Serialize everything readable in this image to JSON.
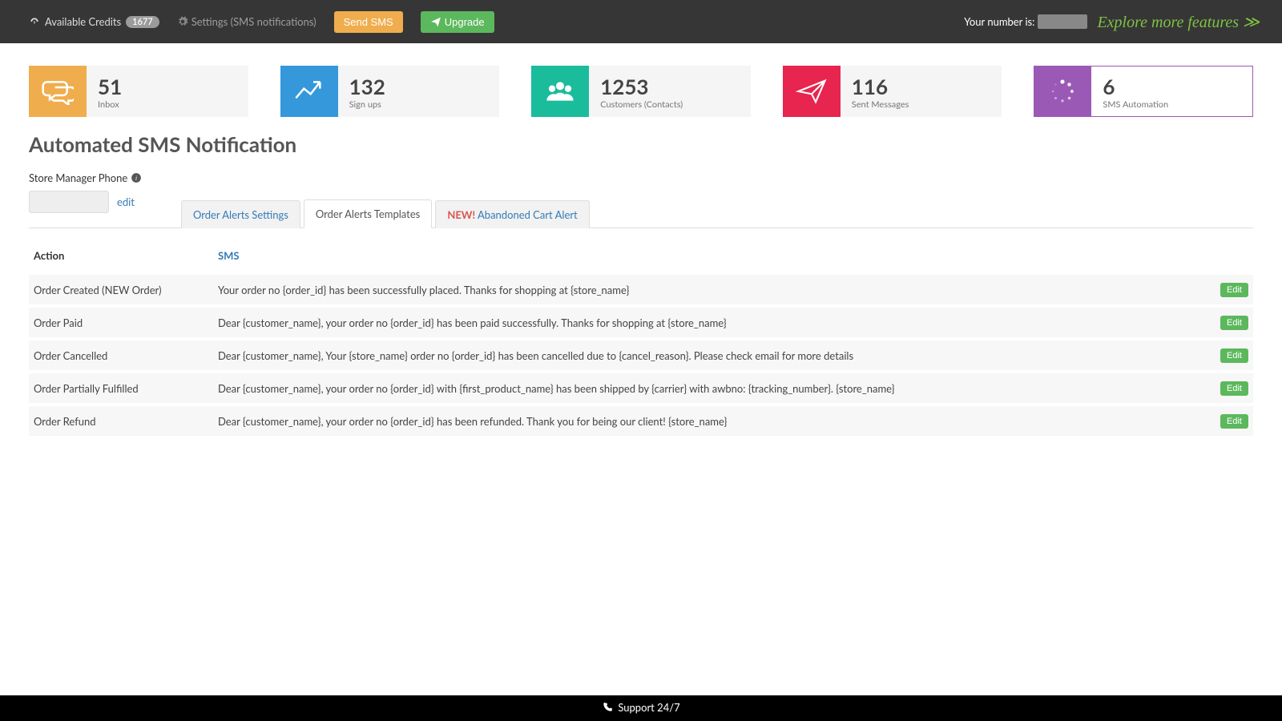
{
  "header": {
    "credits_label": "Available Credits",
    "credits_value": "1677",
    "settings_label": "Settings (SMS notifications)",
    "send_sms_label": "Send SMS",
    "upgrade_label": "Upgrade",
    "your_number_label": "Your number is:",
    "explore_label": "Explore more features ≫"
  },
  "stats": [
    {
      "value": "51",
      "label": "Inbox"
    },
    {
      "value": "132",
      "label": "Sign ups"
    },
    {
      "value": "1253",
      "label": "Customers (Contacts)"
    },
    {
      "value": "116",
      "label": "Sent Messages"
    },
    {
      "value": "6",
      "label": "SMS Automation"
    }
  ],
  "page": {
    "title": "Automated SMS Notification",
    "store_phone_label": "Store Manager Phone",
    "edit_label": "edit"
  },
  "tabs": {
    "settings": "Order Alerts Settings",
    "templates": "Order Alerts Templates",
    "abandoned_new": "NEW!",
    "abandoned": "Abandoned Cart Alert"
  },
  "table": {
    "col_action": "Action",
    "col_sms": "SMS",
    "edit_label": "Edit",
    "rows": [
      {
        "action": "Order Created (NEW Order)",
        "sms": "Your order no {order_id} has been successfully placed. Thanks for shopping at {store_name}"
      },
      {
        "action": "Order Paid",
        "sms": "Dear {customer_name}, your order no {order_id} has been paid successfully. Thanks for shopping at {store_name}"
      },
      {
        "action": "Order Cancelled",
        "sms": "Dear {customer_name}, Your {store_name} order no {order_id} has been cancelled due to {cancel_reason}. Please check email for more details"
      },
      {
        "action": "Order Partially Fulfilled",
        "sms": "Dear {customer_name}, your order no {order_id} with {first_product_name} has been shipped by {carrier} with awbno: {tracking_number}. {store_name}"
      },
      {
        "action": "Order Refund",
        "sms": "Dear {customer_name}, your order no {order_id} has been refunded. Thank you for being our client! {store_name}"
      }
    ]
  },
  "footer": {
    "support_label": "Support 24/7"
  }
}
